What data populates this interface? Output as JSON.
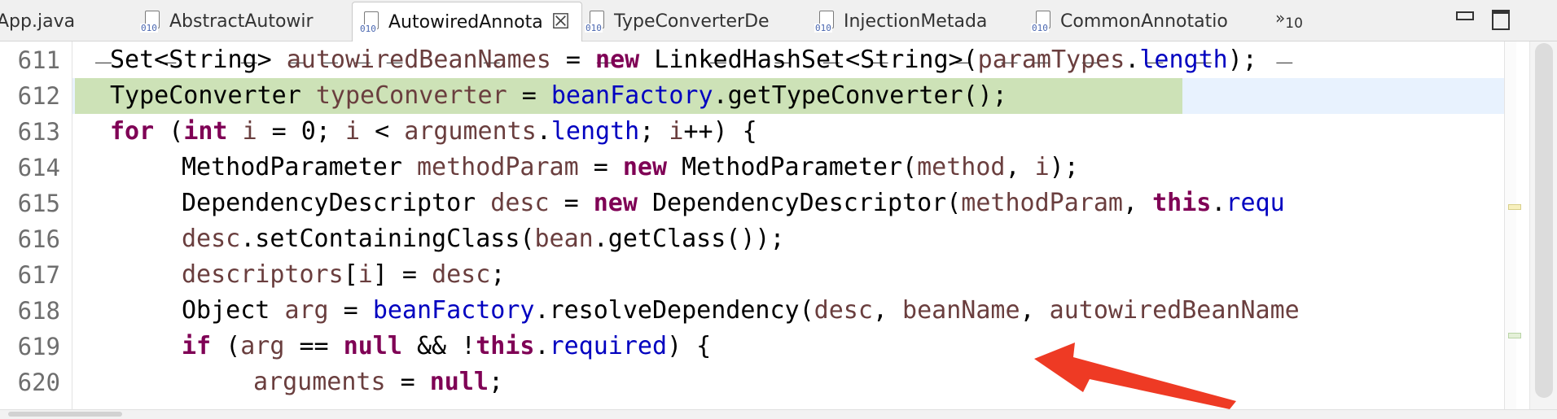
{
  "tabs": [
    {
      "label": "App.java",
      "active": false
    },
    {
      "label": "AbstractAutowir",
      "active": false
    },
    {
      "label": "AutowiredAnnota",
      "active": true
    },
    {
      "label": "TypeConverterDe",
      "active": false
    },
    {
      "label": "InjectionMetada",
      "active": false
    },
    {
      "label": "CommonAnnotatio",
      "active": false
    }
  ],
  "class_file_icon_text": "010",
  "overflow": {
    "chevron": "»",
    "count": "10"
  },
  "window_controls": {
    "minimize_icon": "minimize-icon",
    "maximize_icon": "maximize-icon"
  },
  "colors": {
    "keyword": "#7f0055",
    "field": "#0000c0",
    "local_variable": "#6a3e3e",
    "highlight_line": "#cde2b7",
    "current_line": "#e8f2fe",
    "annotation_arrow": "#ee3a24"
  },
  "editor": {
    "clipped_top_line": "_   _    _  _ _ _ _     _      _      _   _  _  _    _  _ _  _   _  _    _",
    "lines": [
      {
        "num": "611",
        "text": "    Set<String> autowiredBeanNames = new LinkedHashSet<String>(paramTypes.length);"
      },
      {
        "num": "612",
        "text": "    TypeConverter typeConverter = beanFactory.getTypeConverter();"
      },
      {
        "num": "613",
        "text": "    for (int i = 0; i < arguments.length; i++) {"
      },
      {
        "num": "614",
        "text": "        MethodParameter methodParam = new MethodParameter(method, i);"
      },
      {
        "num": "615",
        "text": "        DependencyDescriptor desc = new DependencyDescriptor(methodParam, this.requ"
      },
      {
        "num": "616",
        "text": "        desc.setContainingClass(bean.getClass());"
      },
      {
        "num": "617",
        "text": "        descriptors[i] = desc;"
      },
      {
        "num": "618",
        "text": "        Object arg = beanFactory.resolveDependency(desc, beanName, autowiredBeanName"
      },
      {
        "num": "619",
        "text": "        if (arg == null && !this.required) {"
      },
      {
        "num": "620",
        "text": "            arguments = null;"
      }
    ],
    "tokens": {
      "l611": [
        "Set<String> ",
        "autowiredBeanNames",
        " = ",
        "new",
        " LinkedHashSet<String>(",
        "paramTypes",
        ".",
        "length",
        ");"
      ],
      "l612": [
        "TypeConverter ",
        "typeConverter",
        " = ",
        "beanFactory",
        ".getTypeConverter();"
      ],
      "l613": [
        "for",
        " (",
        "int",
        " ",
        "i",
        " = 0; ",
        "i",
        " < ",
        "arguments",
        ".",
        "length",
        "; ",
        "i",
        "++) {"
      ],
      "l614": [
        "MethodParameter ",
        "methodParam",
        " = ",
        "new",
        " MethodParameter(",
        "method",
        ", ",
        "i",
        ");"
      ],
      "l615": [
        "DependencyDescriptor ",
        "desc",
        " = ",
        "new",
        " DependencyDescriptor(",
        "methodParam",
        ", ",
        "this",
        ".",
        "requ"
      ],
      "l616": [
        "desc",
        ".setContainingClass(",
        "bean",
        ".getClass());"
      ],
      "l617": [
        "descriptors",
        "[",
        "i",
        "] = ",
        "desc",
        ";"
      ],
      "l618": [
        "Object ",
        "arg",
        " = ",
        "beanFactory",
        ".resolveDependency(",
        "desc",
        ", ",
        "beanName",
        ", ",
        "autowiredBeanName"
      ],
      "l619": [
        "if",
        " (",
        "arg",
        " == ",
        "null",
        " && !",
        "this",
        ".",
        "required",
        ") {"
      ],
      "l620": [
        "arguments",
        " = ",
        "null",
        ";"
      ]
    }
  }
}
